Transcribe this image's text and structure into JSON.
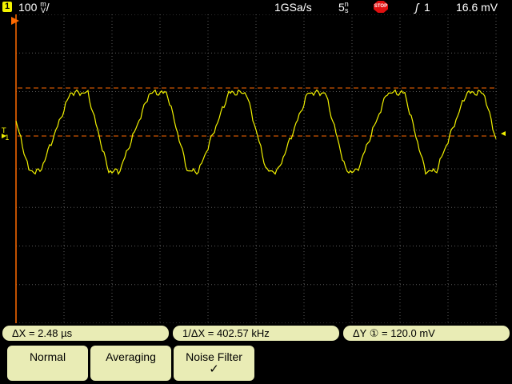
{
  "status_bar": {
    "channel_number": "1",
    "volts_per_div_value": "100",
    "volts_per_div_unit_top": "m",
    "volts_per_div_unit_bottom": "V",
    "sample_rate": "1GSa/s",
    "time_per_div_value": "5",
    "time_per_div_unit_top": "n",
    "time_per_div_unit_bottom": "s",
    "run_state": "STOP",
    "trigger_slope_symbol": "ʃ",
    "trigger_source": "1",
    "trigger_level": "16.6 mV"
  },
  "display": {
    "channel1_color": "#f2f200",
    "cursor_color": "#ff6a00",
    "marker_labels": {
      "trigger": "T",
      "ground": "1"
    }
  },
  "measurements": {
    "delta_x": "ΔX =  2.48 µs",
    "inverse_delta_x": "1/ΔX = 402.57 kHz",
    "delta_y": "ΔY ① = 120.0 mV"
  },
  "softkeys": [
    {
      "label": "Normal"
    },
    {
      "label": "Averaging"
    },
    {
      "label": "Noise Filter",
      "checked": "✓"
    }
  ]
}
